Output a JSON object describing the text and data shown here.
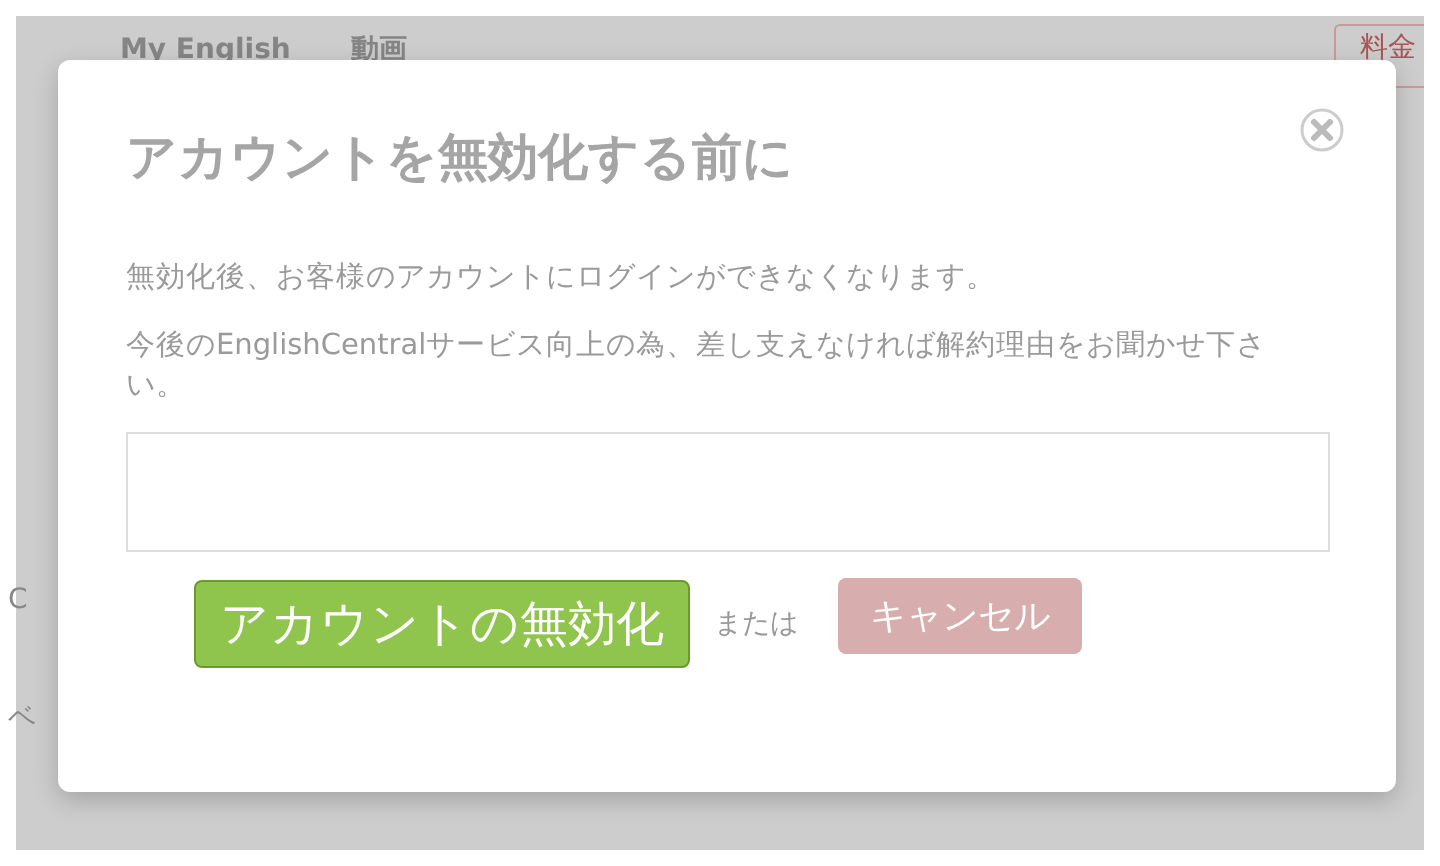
{
  "background_page": {
    "nav": [
      "My English",
      "動画"
    ],
    "pricing_button": "料金",
    "fragments": [
      "C",
      "ベ"
    ]
  },
  "dialog": {
    "title": "アカウントを無効化する前に",
    "paragraphs": [
      "無効化後、お客様のアカウントにログインができなくなります。",
      "今後のEnglishCentralサービス向上の為、差し支えなければ解約理由をお聞かせ下さい。"
    ],
    "deactivate_button": "アカウントの無効化",
    "or_text": "または",
    "cancel_button": "キャンセル"
  }
}
